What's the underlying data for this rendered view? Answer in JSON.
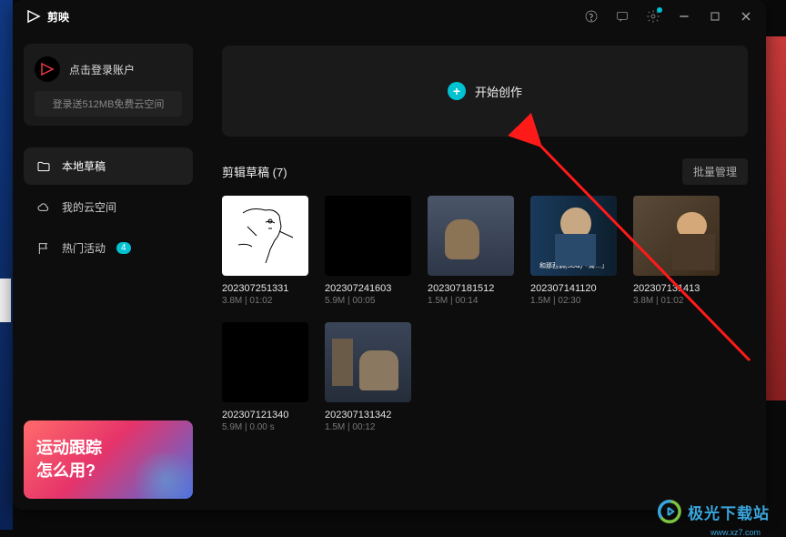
{
  "app_name": "剪映",
  "login": {
    "prompt": "点击登录账户",
    "sub": "登录送512MB免费云空间"
  },
  "nav": {
    "local_drafts": "本地草稿",
    "cloud_space": "我的云空间",
    "activities": "热门活动",
    "activity_badge": "4"
  },
  "promo": {
    "line1": "运动跟踪",
    "line2": "怎么用?"
  },
  "create_button": "开始创作",
  "drafts": {
    "title_prefix": "剪辑草稿",
    "count_display": "(7)",
    "batch_manage": "批量管理",
    "items": [
      {
        "name": "202307251331",
        "meta": "3.8M | 01:02",
        "thumb": "sketch"
      },
      {
        "name": "202307241603",
        "meta": "5.9M | 00:05",
        "thumb": "black"
      },
      {
        "name": "202307181512",
        "meta": "1.5M | 00:14",
        "thumb": "scene1"
      },
      {
        "name": "202307141120",
        "meta": "1.5M | 02:30",
        "thumb": "scene2",
        "caption": "和那茜调(SD&)「周…」"
      },
      {
        "name": "202307131413",
        "meta": "3.8M | 01:02",
        "thumb": "scene3"
      },
      {
        "name": "202307121340",
        "meta": "5.9M | 0.00 s",
        "thumb": "black"
      },
      {
        "name": "202307131342",
        "meta": "1.5M | 00:12",
        "thumb": "scene4"
      }
    ]
  },
  "watermark": {
    "text": "极光下载站",
    "url": "www.xz7.com"
  }
}
